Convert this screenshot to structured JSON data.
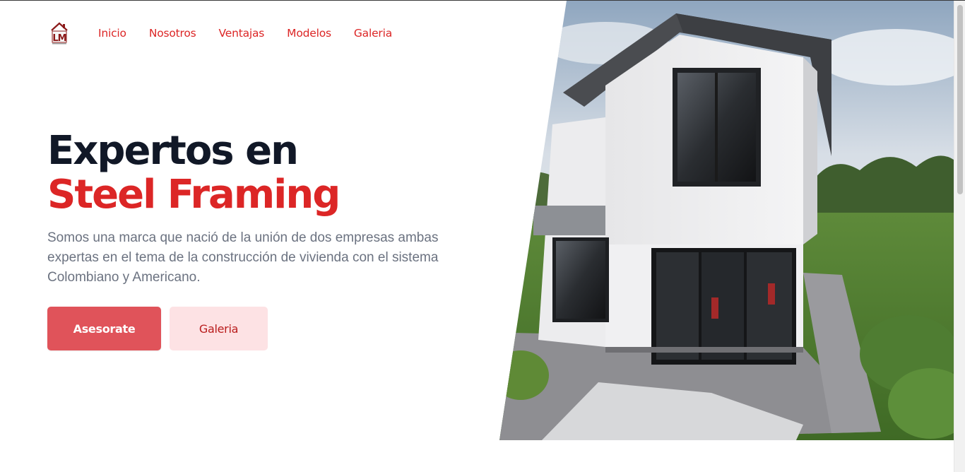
{
  "nav": {
    "logo_text": "LM",
    "links": [
      "Inicio",
      "Nosotros",
      "Ventajas",
      "Modelos",
      "Galeria"
    ]
  },
  "hero": {
    "title_line1": "Expertos en",
    "title_line2": "Steel Framing",
    "description": "Somos una marca que nació de la unión de dos empresas ambas expertas en el tema de la construcción de vivienda con el sistema Colombiano y Americano.",
    "primary_button": "Asesorate",
    "secondary_button": "Galeria"
  },
  "colors": {
    "brand": "#dc2626",
    "heading": "#111827",
    "text_muted": "#6b7280",
    "primary_button_bg": "#e0535a",
    "secondary_button_bg": "#fde2e4"
  }
}
